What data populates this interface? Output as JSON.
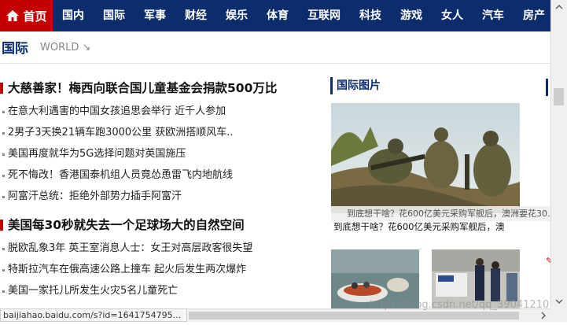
{
  "nav": {
    "home_label": "首页",
    "items": [
      "国内",
      "国际",
      "军事",
      "财经",
      "娱乐",
      "体育",
      "互联网",
      "科技",
      "游戏",
      "女人",
      "汽车",
      "房产"
    ]
  },
  "section": {
    "title_cn": "国际",
    "title_en": "WORLD ↘"
  },
  "group1": {
    "headline": "大慈善家！梅西向联合国儿童基金会捐款500万比",
    "items": [
      "在意大利遇害的中国女孩追思会举行 近千人参加",
      "2男子3天换21辆车跑3000公里 获欧洲搭顺风车..",
      "美国再度就华为5G选择问题对英国施压",
      "死不悔改！香港国泰机组人员竟怂恿雷飞内地航线",
      "阿富汗总统：拒绝外部势力插手阿富汗"
    ]
  },
  "group2": {
    "headline": "美国每30秒就失去一个足球场大的自然空间",
    "items": [
      "脱欧乱象3年 英王室消息人士：女王对高层政客很失望",
      "特斯拉汽车在俄高速公路上撞车 起火后发生两次爆炸",
      "美国一家托儿所发生火灾5名儿童死亡"
    ]
  },
  "pictures": {
    "title": "国际图片",
    "overlay_caption": "到底想干啥？花600亿美元采购军舰后，澳洲要花30...",
    "caption": "到底想干啥？花600亿美元采购军舰后，澳"
  },
  "status_url": "baijiahao.baidu.com/s?id=1641754795...",
  "watermark": "https://blog.csdn.net/qq_39041210",
  "colors": {
    "nav_bg": "#0d2c6b",
    "home_bg": "#c40000",
    "accent_red": "#c40000"
  }
}
